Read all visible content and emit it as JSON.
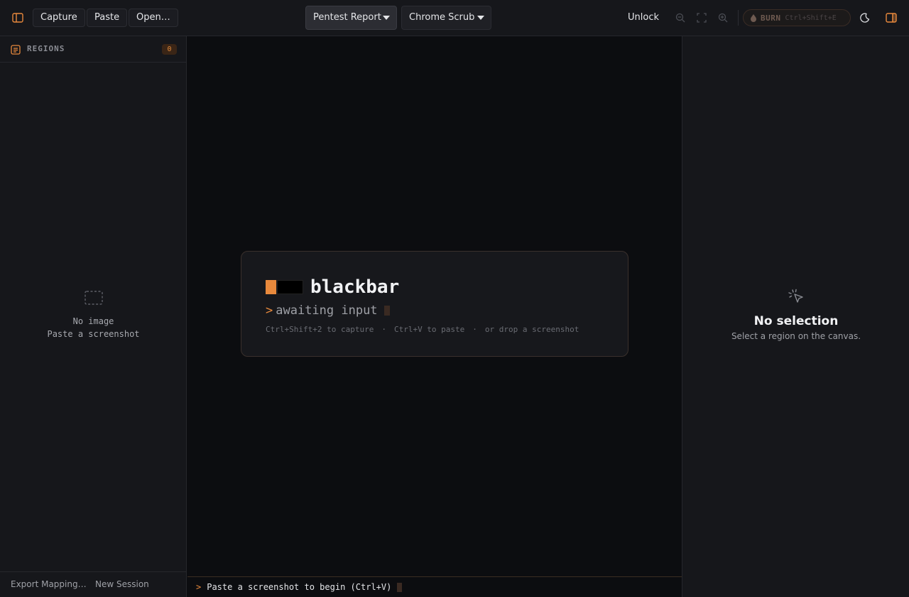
{
  "toolbar": {
    "sidebar_toggle_icon": "sidebar-left-icon",
    "capture_label": "Capture",
    "paste_label": "Paste",
    "open_label": "Open…",
    "profile_select": "Pentest Report",
    "mode_select": "Chrome Scrub",
    "unlock_label": "Unlock",
    "zoom_out_icon": "zoom-out-icon",
    "fit_icon": "fit-screen-icon",
    "zoom_in_icon": "zoom-in-icon",
    "burn_label": "BURN",
    "burn_shortcut": "Ctrl+Shift+E",
    "theme_icon": "moon-icon",
    "right_panel_toggle_icon": "sidebar-right-icon"
  },
  "regions": {
    "title": "REGIONS",
    "count": "0",
    "empty_title": "No image",
    "empty_hint": "Paste a screenshot",
    "export_label": "Export Mapping…",
    "new_session_label": "New Session"
  },
  "welcome": {
    "app_name": "blackbar",
    "prompt": ">",
    "status": "awaiting input",
    "hint_capture": "Ctrl+Shift+2 to capture",
    "hint_paste": "Ctrl+V to paste",
    "hint_drop": "or drop a screenshot",
    "separator": "·"
  },
  "statusbar": {
    "prompt": ">",
    "message": "Paste a screenshot to begin (Ctrl+V)"
  },
  "inspector": {
    "empty_title": "No selection",
    "empty_hint": "Select a region on the canvas."
  },
  "colors": {
    "accent": "#e8893c",
    "background": "#0c0d10",
    "panel": "#16171b"
  }
}
